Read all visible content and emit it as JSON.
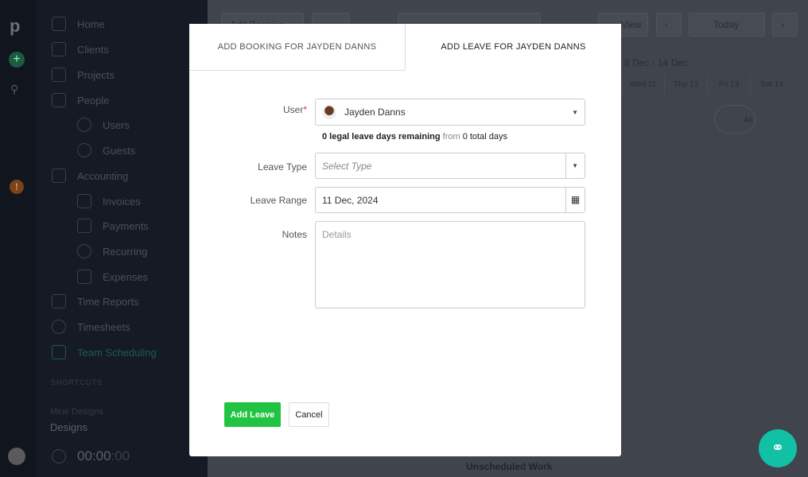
{
  "sidebar": {
    "items": [
      {
        "label": "Home"
      },
      {
        "label": "Clients"
      },
      {
        "label": "Projects"
      },
      {
        "label": "People"
      },
      {
        "label": "Users"
      },
      {
        "label": "Guests"
      },
      {
        "label": "Accounting"
      },
      {
        "label": "Invoices"
      },
      {
        "label": "Payments"
      },
      {
        "label": "Recurring"
      },
      {
        "label": "Expenses"
      },
      {
        "label": "Time Reports"
      },
      {
        "label": "Timesheets"
      },
      {
        "label": "Team Scheduling"
      }
    ],
    "shortcuts_label": "SHORTCUTS",
    "project_client": "Mine Designs",
    "project_name": "Designs",
    "timer": {
      "main": "00:00",
      "seconds": ":00"
    },
    "active_color": "#1f5a4e"
  },
  "toolbar": {
    "add_booking": "Add Booking",
    "view": "View",
    "today": "Today"
  },
  "calendar": {
    "week": "8 Dec - 14 Dec",
    "days": [
      "Wed 11",
      "Thu 12",
      "Fri 13",
      "Sat 14"
    ],
    "booking_label": "As"
  },
  "footer": {
    "unscheduled": "Unscheduled Work"
  },
  "modal": {
    "tabs": [
      {
        "label": "ADD BOOKING FOR JAYDEN DANNS",
        "active": false
      },
      {
        "label": "ADD LEAVE FOR JAYDEN DANNS",
        "active": true
      }
    ],
    "user_label": "User",
    "required": "*",
    "user_value": "Jayden Danns",
    "leave_info": {
      "remaining": "0 legal leave days remaining",
      "from": "from",
      "total": "0 total days"
    },
    "leave_type_label": "Leave Type",
    "leave_type_placeholder": "Select Type",
    "leave_range_label": "Leave Range",
    "leave_range_value": "11 Dec, 2024",
    "notes_label": "Notes",
    "notes_placeholder": "Details",
    "add_button": "Add Leave",
    "cancel_button": "Cancel",
    "accent": "#22c343"
  }
}
